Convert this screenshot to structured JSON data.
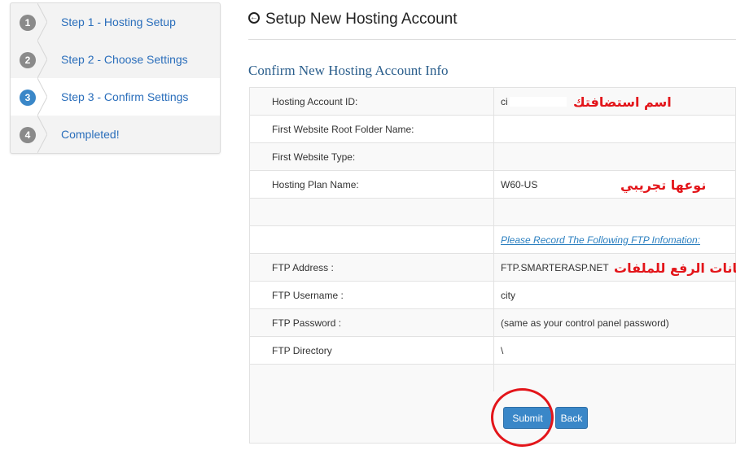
{
  "steps": [
    {
      "number": "1",
      "label": "Step 1 - Hosting Setup",
      "active": false
    },
    {
      "number": "2",
      "label": "Step 2 - Choose Settings",
      "active": false
    },
    {
      "number": "3",
      "label": "Step 3 - Confirm Settings",
      "active": true
    },
    {
      "number": "4",
      "label": "Completed!",
      "active": false
    }
  ],
  "header": {
    "title": "Setup New Hosting Account",
    "icon": "circle-arrow-left-icon"
  },
  "section_title": "Confirm New Hosting Account Info",
  "rows": {
    "account_id": {
      "label": "Hosting Account ID:",
      "value": "ci"
    },
    "root_folder": {
      "label": "First Website Root Folder Name:",
      "value": ""
    },
    "site_type": {
      "label": "First Website Type:",
      "value": ""
    },
    "plan_name": {
      "label": "Hosting Plan Name:",
      "value": "W60-US"
    },
    "ftp_note": "Please Record The Following FTP Infomation:",
    "ftp_address": {
      "label": "FTP Address :",
      "value": "FTP.SMARTERASP.NET"
    },
    "ftp_username": {
      "label": "FTP Username :",
      "value": "city"
    },
    "ftp_password": {
      "label": "FTP Password :",
      "value": "(same as your control panel password)"
    },
    "ftp_directory": {
      "label": "FTP Directory",
      "value": "\\"
    }
  },
  "buttons": {
    "submit": "Submit",
    "back": "Back"
  },
  "annotations": {
    "account_name": "اسم استضافتك",
    "trial_type": "نوعها تجريبي",
    "upload_data": "بيانات الرفع للملفات"
  },
  "colors": {
    "accent": "#3a87c8",
    "link": "#2a6ebb",
    "annotation": "#e3151a"
  }
}
